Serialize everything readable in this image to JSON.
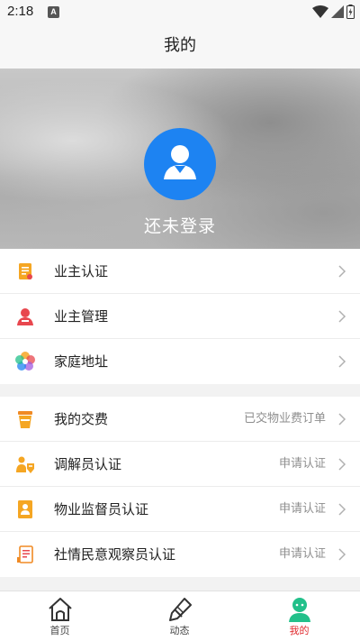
{
  "status_bar": {
    "time": "2:18",
    "notification_badge": "A"
  },
  "nav": {
    "title": "我的"
  },
  "profile": {
    "login_text": "还未登录",
    "avatar_color": "#1d83f2"
  },
  "group1": [
    {
      "label": "业主认证",
      "icon": "certificate-icon"
    },
    {
      "label": "业主管理",
      "icon": "owner-manage-icon"
    },
    {
      "label": "家庭地址",
      "icon": "family-address-icon"
    }
  ],
  "group2": [
    {
      "label": "我的交费",
      "value": "已交物业费订单",
      "icon": "payment-cup-icon"
    },
    {
      "label": "调解员认证",
      "value": "申请认证",
      "icon": "mediator-icon"
    },
    {
      "label": "物业监督员认证",
      "value": "申请认证",
      "icon": "supervisor-badge-icon"
    },
    {
      "label": "社情民意观察员认证",
      "value": "申请认证",
      "icon": "observer-document-icon"
    }
  ],
  "tabs": [
    {
      "label": "首页",
      "icon": "home-icon",
      "active": false
    },
    {
      "label": "动态",
      "icon": "pen-icon",
      "active": false
    },
    {
      "label": "我的",
      "icon": "profile-icon",
      "active": true
    }
  ],
  "colors": {
    "accent_blue": "#1d83f2",
    "active_tab": "#e0282c",
    "profile_tab_icon": "#22c08a"
  }
}
